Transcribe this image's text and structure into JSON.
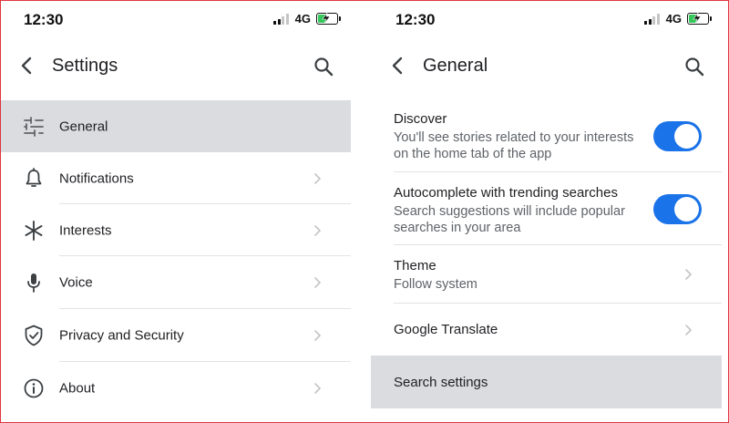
{
  "left": {
    "status": {
      "time": "12:30",
      "network": "4G"
    },
    "appbar": {
      "title": "Settings"
    },
    "items": [
      {
        "label": "General",
        "icon": "tune-icon",
        "selected": true
      },
      {
        "label": "Notifications",
        "icon": "bell-icon"
      },
      {
        "label": "Interests",
        "icon": "asterisk-icon"
      },
      {
        "label": "Voice",
        "icon": "microphone-icon"
      },
      {
        "label": "Privacy and Security",
        "icon": "shield-check-icon"
      },
      {
        "label": "About",
        "icon": "info-icon"
      }
    ]
  },
  "right": {
    "status": {
      "time": "12:30",
      "network": "4G"
    },
    "appbar": {
      "title": "General"
    },
    "discover": {
      "title": "Discover",
      "subtitle": "You'll see stories related to your interests on the home tab of the app",
      "enabled": true
    },
    "autocomplete": {
      "title": "Autocomplete with trending searches",
      "subtitle": "Search suggestions will include popular searches in your area",
      "enabled": true
    },
    "theme": {
      "title": "Theme",
      "subtitle": "Follow system"
    },
    "translate": {
      "title": "Google Translate"
    },
    "search_settings": {
      "title": "Search settings"
    }
  },
  "colors": {
    "accent": "#1a73e8",
    "selected_bg": "#dadce0",
    "battery": "#34c759",
    "frame": "#e0363e"
  }
}
